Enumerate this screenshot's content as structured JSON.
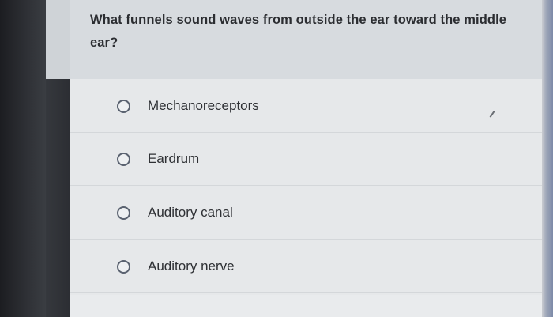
{
  "question": {
    "line1": "What funnels sound waves from outside the ear toward the middle",
    "line2": "ear?"
  },
  "options": [
    {
      "label": "Mechanoreceptors",
      "selected": false
    },
    {
      "label": "Eardrum",
      "selected": false
    },
    {
      "label": "Auditory canal",
      "selected": false
    },
    {
      "label": "Auditory nerve",
      "selected": false
    }
  ],
  "colors": {
    "question_bg": "#d7dbdf",
    "card_bg": "#e6e8ea",
    "text": "#2b2d31",
    "radio_border": "#5a6270"
  }
}
